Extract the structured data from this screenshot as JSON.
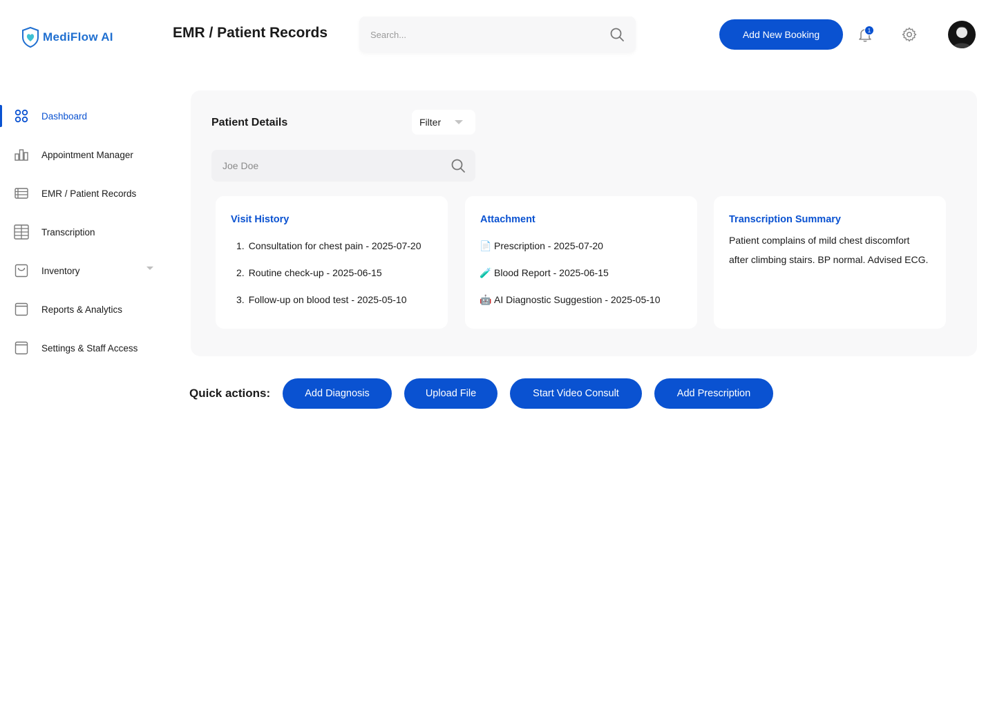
{
  "brand": {
    "name": "MediFlow AI",
    "accent": "#0a52d1"
  },
  "header": {
    "title": "EMR / Patient Records",
    "search_placeholder": "Search...",
    "add_booking_label": "Add New Booking",
    "notification_count": "1"
  },
  "sidebar": {
    "items": [
      {
        "label": "Dashboard",
        "icon": "grid-icon",
        "active": true
      },
      {
        "label": "Appointment Manager",
        "icon": "bar-chart-icon"
      },
      {
        "label": "EMR / Patient Records",
        "icon": "table-icon"
      },
      {
        "label": "Transcription",
        "icon": "columns-icon"
      },
      {
        "label": "Inventory",
        "icon": "shopping-bag-icon",
        "has_dropdown": true
      },
      {
        "label": "Reports & Analytics",
        "icon": "window-icon"
      },
      {
        "label": "Settings & Staff Access",
        "icon": "window-icon"
      }
    ]
  },
  "patient_details": {
    "title": "Patient Details",
    "filter_label": "Filter",
    "search_value": "Joe Doe"
  },
  "visit_history": {
    "title": "Visit History",
    "items": [
      {
        "num": "1.",
        "text": "Consultation for chest pain - 2025-07-20"
      },
      {
        "num": "2.",
        "text": "Routine check-up - 2025-06-15"
      },
      {
        "num": "3.",
        "text": "Follow-up on blood test - 2025-05-10"
      }
    ]
  },
  "attachment": {
    "title": "Attachment",
    "items": [
      {
        "icon": "document-icon",
        "emoji": "📄",
        "text": "Prescription - 2025-07-20"
      },
      {
        "icon": "test-tube-icon",
        "emoji": "🧪",
        "text": "Blood Report - 2025-06-15"
      },
      {
        "icon": "robot-icon",
        "emoji": "🤖",
        "text": "AI Diagnostic Suggestion - 2025-05-10"
      }
    ]
  },
  "transcription_summary": {
    "title": "Transcription Summary",
    "line1": "Patient complains of mild chest discomfort",
    "line2": "after climbing stairs. BP normal. Advised ECG."
  },
  "quick_actions": {
    "label": "Quick actions:",
    "buttons": [
      "Add Diagnosis",
      "Upload File",
      "Start Video Consult",
      "Add Prescription"
    ]
  }
}
